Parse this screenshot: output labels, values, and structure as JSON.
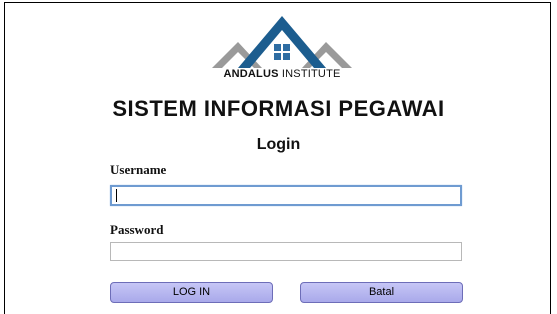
{
  "brand": {
    "logo_text_bold": "ANDALUS",
    "logo_text_rest": " INSTITUTE",
    "colors": {
      "mountain": "#9a9a9a",
      "roof": "#1c5d8f",
      "window": "#2e6da3"
    }
  },
  "header": {
    "title": "SISTEM INFORMASI PEGAWAI",
    "subtitle": "Login"
  },
  "form": {
    "username_label": "Username",
    "username_value": "",
    "password_label": "Password",
    "password_value": "",
    "login_button": "LOG IN",
    "cancel_button": "Batal"
  }
}
